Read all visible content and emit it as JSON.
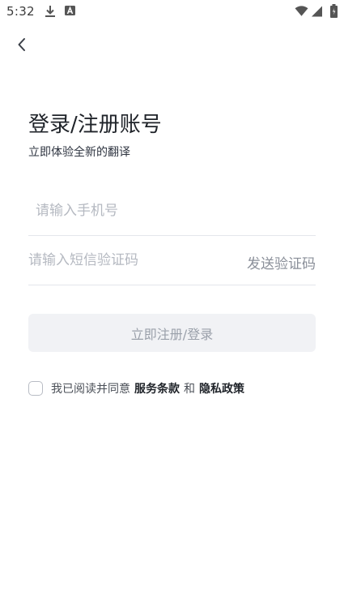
{
  "status_bar": {
    "time": "5:32",
    "icons": [
      "download-icon",
      "a-letter-icon",
      "wifi-icon",
      "signal-icon",
      "battery-icon"
    ]
  },
  "header": {
    "back_icon": "chevron-left-icon"
  },
  "page": {
    "title": "登录/注册账号",
    "subtitle": "立即体验全新的翻译"
  },
  "form": {
    "phone_placeholder": "请输入手机号",
    "code_placeholder": "请输入短信验证码",
    "send_code_label": "发送验证码",
    "submit_label": "立即注册/登录"
  },
  "agreement": {
    "prefix": "我已阅读并同意",
    "terms_link": "服务条款",
    "and": "和",
    "privacy_link": "隐私政策",
    "checked": false
  },
  "colors": {
    "background": "#ffffff",
    "title_text": "#1f2329",
    "placeholder": "#b5b9c1",
    "button_bg": "#f1f2f5",
    "button_text": "#9aa0aa",
    "divider": "#e4e6eb"
  }
}
